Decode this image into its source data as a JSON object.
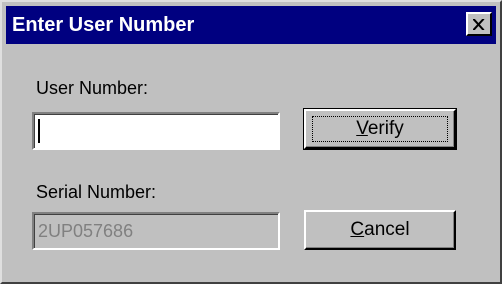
{
  "window": {
    "title": "Enter User Number",
    "close_icon": "close-x-icon"
  },
  "form": {
    "user_number": {
      "label": "User Number:",
      "value": ""
    },
    "serial_number": {
      "label": "Serial Number:",
      "value": "2UP057686",
      "disabled": true
    }
  },
  "buttons": {
    "verify": {
      "mnemonic": "V",
      "rest": "erify",
      "is_default": true
    },
    "cancel": {
      "mnemonic": "C",
      "rest": "ancel"
    }
  },
  "colors": {
    "titlebar": "#000080",
    "face": "#c0c0c0",
    "disabled_text": "#808080"
  }
}
